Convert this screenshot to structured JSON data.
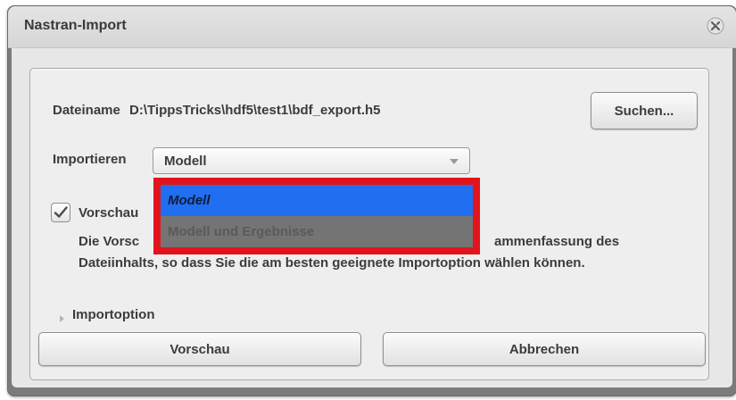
{
  "window": {
    "title": "Nastran-Import",
    "close_icon": "close-icon"
  },
  "file": {
    "label": "Dateiname",
    "path": "D:\\TippsTricks\\hdf5\\test1\\bdf_export.h5",
    "browse_button": "Suchen..."
  },
  "import": {
    "label": "Importieren",
    "selected_value": "Modell",
    "options": [
      "Modell",
      "Modell und Ergebnisse"
    ]
  },
  "preview": {
    "checkbox_label": "Vorschau",
    "checked": true,
    "description": "Die Vorschau zeigt eine Zusammenfassung des Dateiinhalts, so dass Sie die am besten geeignete Importoption wählen können.",
    "visible_description_line1_start": "Die Vorsc",
    "visible_description_line1_end": "ammenfassung des",
    "visible_description_line2": "Dateiinhalts, so dass Sie die am besten geeignete Importoption wählen können."
  },
  "options_section": {
    "label": "Importoption"
  },
  "buttons": {
    "preview": "Vorschau",
    "cancel": "Abbrechen"
  },
  "colors": {
    "highlight_border": "#e1141c",
    "selected_item": "#1f6ff0",
    "dialog_frame": "#7b7b7b"
  }
}
